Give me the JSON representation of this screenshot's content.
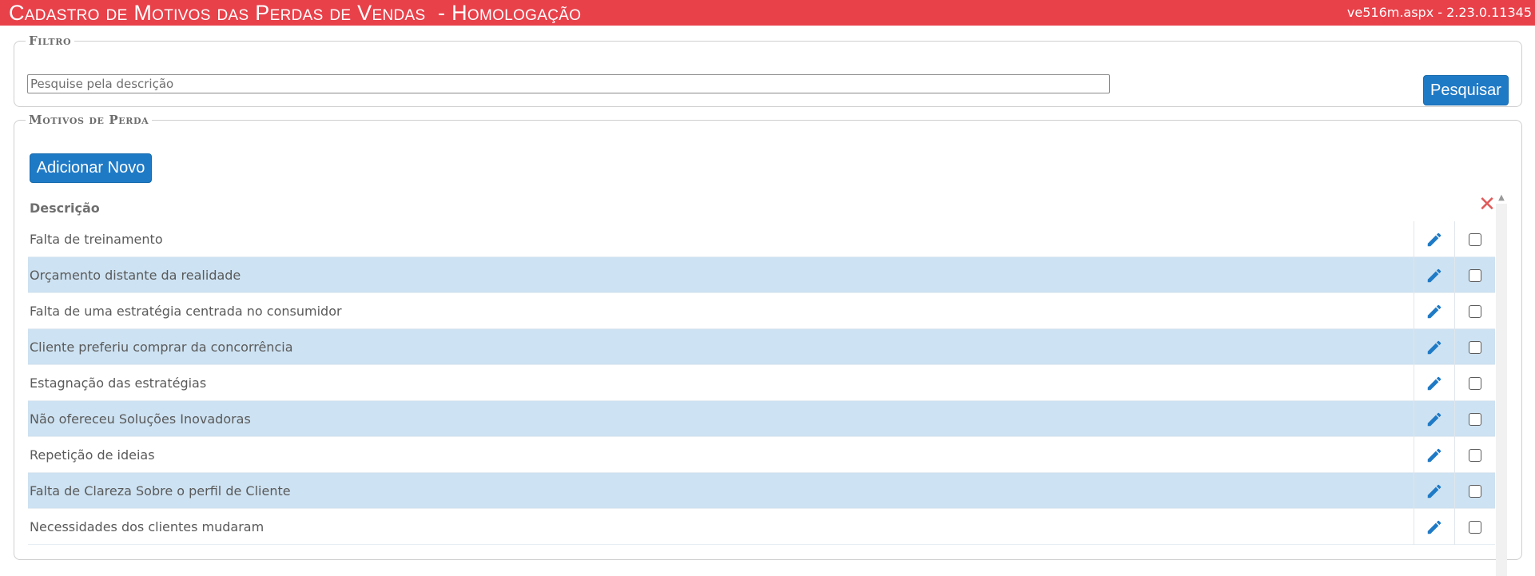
{
  "header": {
    "title": "Cadastro de Motivos das Perdas de Vendas  - Homologação",
    "version": "ve516m.aspx - 2.23.0.11345"
  },
  "filter": {
    "legend": "Filtro",
    "search_placeholder": "Pesquise pela descrição",
    "search_value": "",
    "search_button": "Pesquisar"
  },
  "reasons": {
    "legend": "Motivos de Perda",
    "add_button": "Adicionar Novo",
    "column_description": "Descrição",
    "delete_icon": "close-x-icon",
    "edit_icon": "pencil-icon",
    "rows": [
      {
        "description": "Falta de treinamento"
      },
      {
        "description": "Orçamento distante da realidade"
      },
      {
        "description": "Falta de uma estratégia centrada no consumidor"
      },
      {
        "description": "Cliente preferiu comprar da concorrência"
      },
      {
        "description": "Estagnação das estratégias"
      },
      {
        "description": "Não ofereceu Soluções Inovadoras"
      },
      {
        "description": "Repetição de ideias"
      },
      {
        "description": "Falta de Clareza Sobre o perfil de Cliente"
      },
      {
        "description": "Necessidades dos clientes mudaram"
      }
    ]
  },
  "colors": {
    "title_bar": "#e8414a",
    "button": "#1f7ac6",
    "row_alt": "#cde2f2",
    "delete": "#e05a5a"
  }
}
